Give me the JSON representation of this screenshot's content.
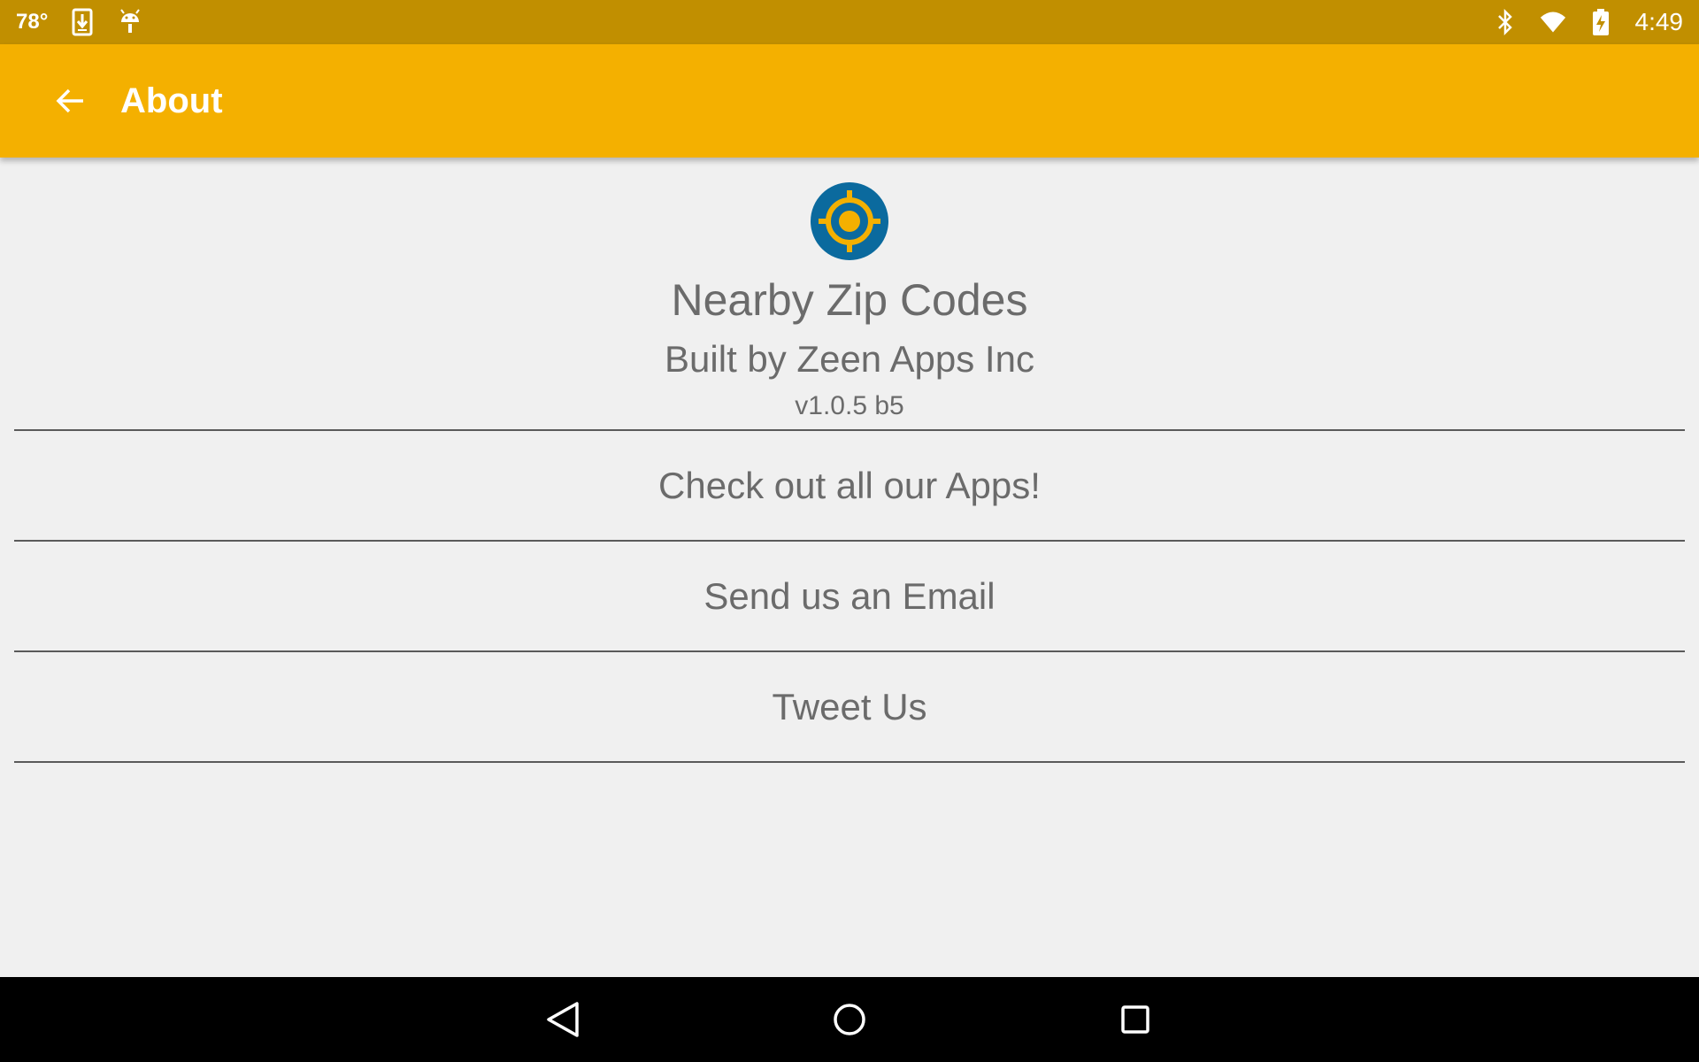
{
  "status_bar": {
    "temperature": "78°",
    "time": "4:49",
    "left_icons": [
      "download-icon",
      "android-icon"
    ],
    "right_icons": [
      "bluetooth-icon",
      "wifi-icon",
      "battery-charging-icon"
    ]
  },
  "app_bar": {
    "title": "About",
    "back_icon": "arrow-back-icon",
    "color": "#f4b000"
  },
  "about": {
    "logo_icon": "target-crosshair-icon",
    "app_name": "Nearby Zip Codes",
    "author": "Built by Zeen Apps Inc",
    "version": "v1.0.5 b5"
  },
  "actions": [
    {
      "label": "Check out all our Apps!"
    },
    {
      "label": "Send us an Email"
    },
    {
      "label": "Tweet Us"
    }
  ],
  "nav_bar": {
    "buttons": [
      "nav-back-icon",
      "nav-home-icon",
      "nav-recents-icon"
    ]
  },
  "colors": {
    "status_bar": "#c18f00",
    "accent": "#f4b000",
    "logo_blue": "#0b6a9e",
    "logo_yellow": "#f4b000",
    "text_gray": "#6b6b6b",
    "background": "#f0f0f0"
  }
}
